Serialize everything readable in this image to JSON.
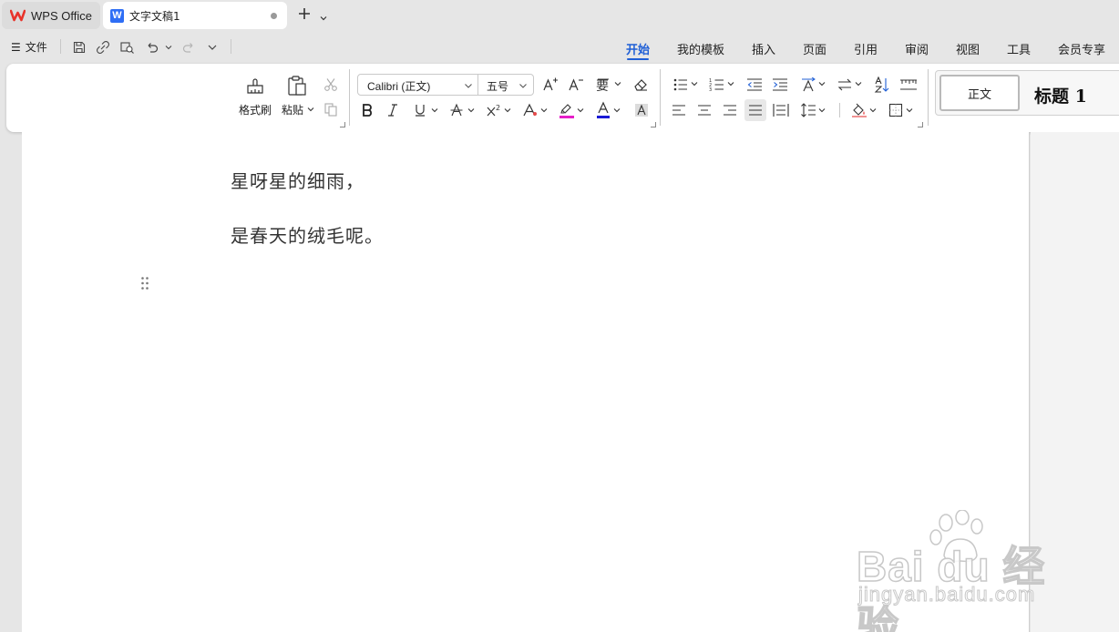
{
  "tabs": {
    "home_label": "WPS Office",
    "doc_label": "文字文稿1",
    "doc_icon_letter": "W"
  },
  "menu": {
    "file_label": "文件",
    "tabs": [
      "开始",
      "我的模板",
      "插入",
      "页面",
      "引用",
      "审阅",
      "视图",
      "工具",
      "会员专享"
    ],
    "active_tab": "开始"
  },
  "ribbon": {
    "format_painter_label": "格式刷",
    "paste_label": "粘贴",
    "font_name": "Calibri (正文)",
    "font_size": "五号",
    "styles": {
      "normal": "正文",
      "heading1": "标题  1"
    },
    "highlight_color": "#e61ec8",
    "font_color": "#1a1ad6"
  },
  "document": {
    "paragraphs": [
      "星呀星的细雨，",
      "是春天的绒毛呢。"
    ]
  },
  "watermark": {
    "brand": "Bai du 经验",
    "url": "jingyan.baidu.com"
  },
  "accent_color": "#1f5fd6"
}
